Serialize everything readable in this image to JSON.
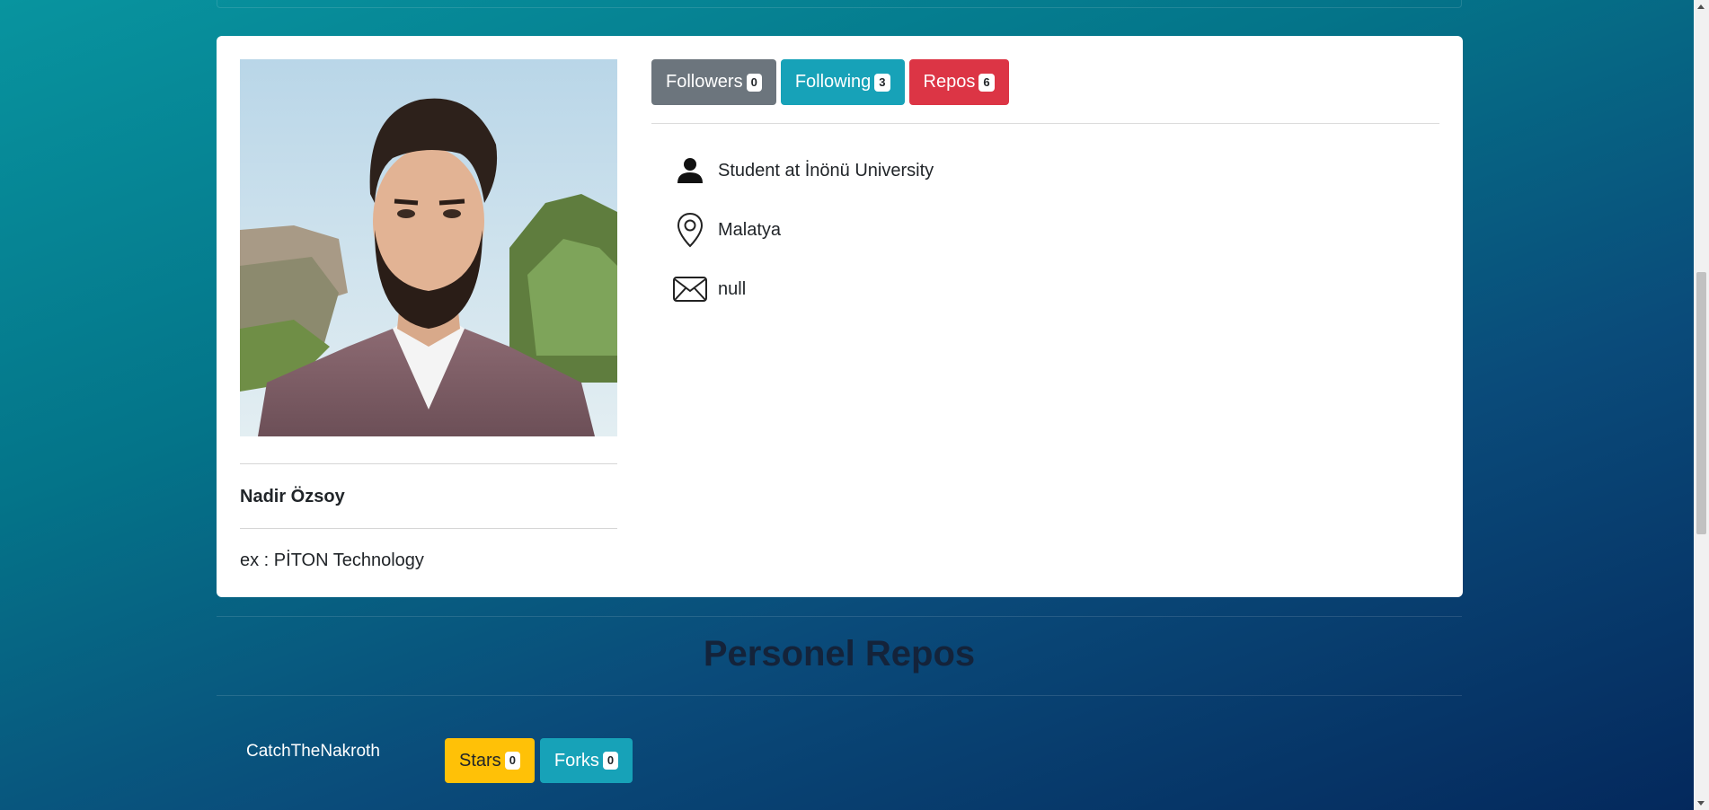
{
  "profile": {
    "name": "Nadir Özsoy",
    "company": "ex : PİTON Technology",
    "avatar_icon": "profile-photo"
  },
  "stats": {
    "followers_label": "Followers",
    "followers_count": "0",
    "following_label": "Following",
    "following_count": "3",
    "repos_label": "Repos",
    "repos_count": "6"
  },
  "info": {
    "bio": "Student at İnönü University",
    "location": "Malatya",
    "email": "null",
    "bio_icon": "person-icon",
    "location_icon": "map-pin-icon",
    "email_icon": "envelope-icon"
  },
  "section": {
    "title": "Personel Repos"
  },
  "repos": [
    {
      "name": "CatchTheNakroth",
      "stars_label": "Stars",
      "stars_count": "0",
      "forks_label": "Forks",
      "forks_count": "0"
    }
  ],
  "colors": {
    "followers": "#6c757d",
    "following": "#17a2b8",
    "repos": "#dc3545",
    "stars": "#ffc107",
    "forks": "#17a2b8"
  }
}
